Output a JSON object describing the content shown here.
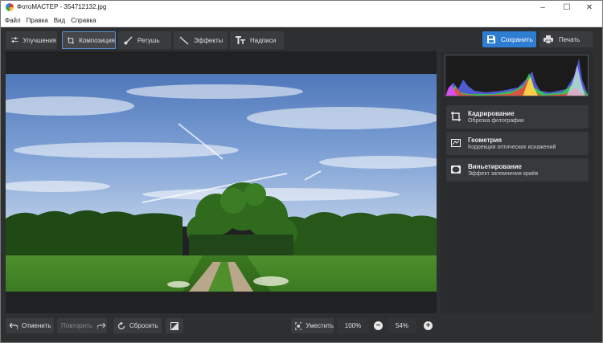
{
  "window": {
    "title": "ФотоМАСТЕР - 354712132.jpg"
  },
  "window_controls": {
    "minimize": "–",
    "maximize": "☐",
    "close": "✕"
  },
  "menu": [
    "Файл",
    "Правка",
    "Вид",
    "Справка"
  ],
  "tabs": [
    {
      "label": "Улучшения",
      "icon": "sliders-icon"
    },
    {
      "label": "Композиция",
      "icon": "crop-icon",
      "active": true
    },
    {
      "label": "Ретушь",
      "icon": "brush-icon"
    },
    {
      "label": "Эффекты",
      "icon": "magic-wand-icon"
    },
    {
      "label": "Надписи",
      "icon": "text-icon"
    }
  ],
  "actions": {
    "save": "Сохранить",
    "print": "Печать"
  },
  "tools": [
    {
      "title": "Кадрирование",
      "subtitle": "Обрезка фотографии",
      "icon": "crop-icon"
    },
    {
      "title": "Геометрия",
      "subtitle": "Коррекция оптических искажений",
      "icon": "geometry-icon"
    },
    {
      "title": "Виньетирование",
      "subtitle": "Эффект затемнения краёв",
      "icon": "vignette-icon"
    }
  ],
  "bottom": {
    "undo": "Отменить",
    "redo": "Повторить",
    "reset": "Сбросить",
    "fit": "Уместить",
    "zoom_actual": "100%",
    "zoom_level": "54%",
    "zoom_out": "−",
    "zoom_in": "+"
  },
  "colors": {
    "accent": "#2d7dd2",
    "background": "#2e2f31",
    "panel": "#38393c"
  }
}
